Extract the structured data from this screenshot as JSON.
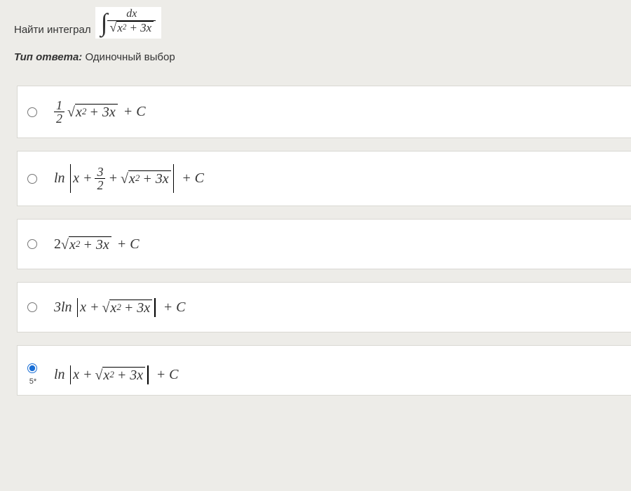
{
  "question": {
    "prompt_label": "Найти интеграл",
    "integral_numerator": "dx",
    "integral_radicand_a": "x",
    "integral_radicand_exp": "2",
    "integral_radicand_b": "+ 3x"
  },
  "answer_type": {
    "label": "Тип ответа:",
    "value": "Одиночный выбор"
  },
  "options": {
    "o1": {
      "frac_n": "1",
      "frac_d": "2",
      "rad_a": "x",
      "rad_exp": "2",
      "rad_b": "+ 3x",
      "tail": "+ C",
      "selected": false
    },
    "o2": {
      "fn": "ln",
      "lead": "x +",
      "frac_n": "3",
      "frac_d": "2",
      "plus": "+",
      "rad_a": "x",
      "rad_exp": "2",
      "rad_b": "+ 3x",
      "tail": "+ C",
      "selected": false
    },
    "o3": {
      "coef": "2",
      "rad_a": "x",
      "rad_exp": "2",
      "rad_b": "+ 3x",
      "tail": "+ C",
      "selected": false
    },
    "o4": {
      "coef_fn": "3ln",
      "lead": "x +",
      "rad_a": "x",
      "rad_exp": "2",
      "rad_b": "+ 3x",
      "tail": "+ C",
      "selected": false
    },
    "o5": {
      "fn": "ln",
      "lead": "x +",
      "rad_a": "x",
      "rad_exp": "2",
      "rad_b": "+ 3x",
      "tail": "+ C",
      "annotation": "5*",
      "selected": true
    }
  }
}
